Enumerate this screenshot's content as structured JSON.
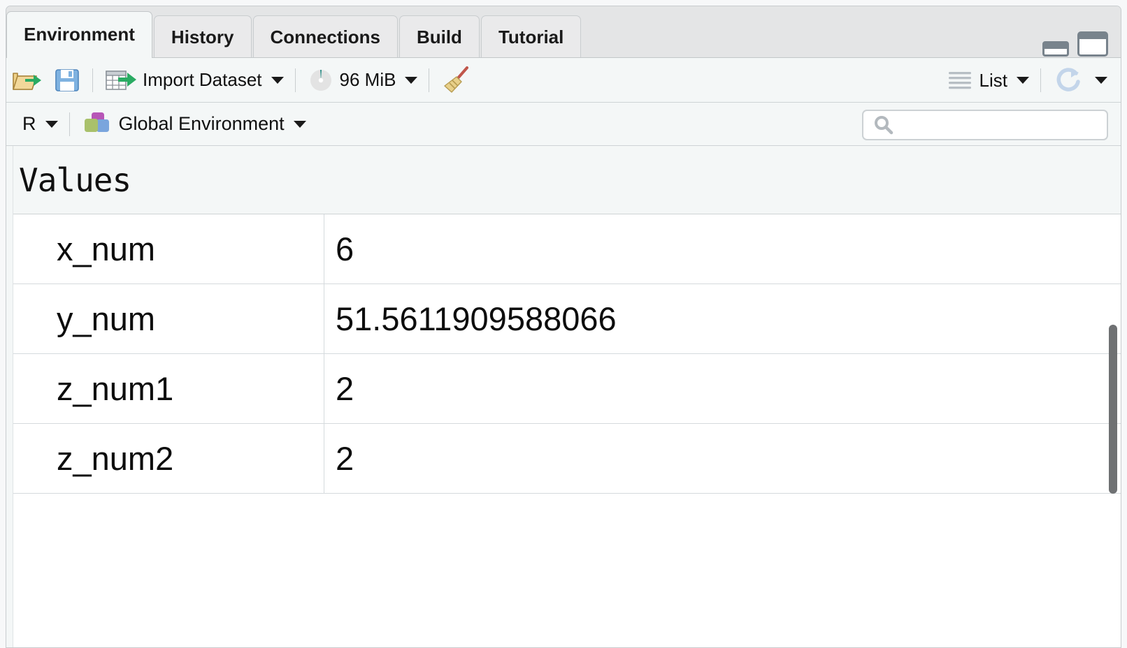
{
  "window": {
    "tabs": [
      {
        "label": "Environment",
        "active": true
      },
      {
        "label": "History",
        "active": false
      },
      {
        "label": "Connections",
        "active": false
      },
      {
        "label": "Build",
        "active": false
      },
      {
        "label": "Tutorial",
        "active": false
      }
    ],
    "minimize_tooltip": "Minimize",
    "maximize_tooltip": "Maximize"
  },
  "toolbar": {
    "open_workspace_icon": "open-folder-icon",
    "save_workspace_icon": "save-disk-icon",
    "import_dataset_label": "Import Dataset",
    "memory_label": "96 MiB",
    "memory_icon": "memory-gauge-icon",
    "clear_icon": "broom-icon",
    "view_mode_label": "List",
    "view_mode_icon": "list-lines-icon",
    "refresh_icon": "refresh-icon"
  },
  "environment": {
    "language_label": "R",
    "scope_label": "Global Environment",
    "scope_icon": "environment-cubes-icon",
    "search_value": "",
    "search_placeholder": "",
    "search_icon": "search-icon"
  },
  "objects": {
    "group_label": "Values",
    "rows": [
      {
        "name": "x_num",
        "value": "6"
      },
      {
        "name": "y_num",
        "value": "51.5611909588066"
      },
      {
        "name": "z_num1",
        "value": "2"
      },
      {
        "name": "z_num2",
        "value": "2"
      }
    ]
  },
  "colors": {
    "pane_background": "#f4f7f7",
    "tabbar_background": "#e4e5e6",
    "active_tab_background": "#f4f7f7",
    "inactive_tab_background": "#eaeaeb",
    "content_background": "#ffffff",
    "border": "#ced3d5",
    "scrollbar_thumb": "#6f7173",
    "accent_green": "#2aab63",
    "accent_blue": "#6fa8dc",
    "accent_yellow": "#e8c56a"
  }
}
